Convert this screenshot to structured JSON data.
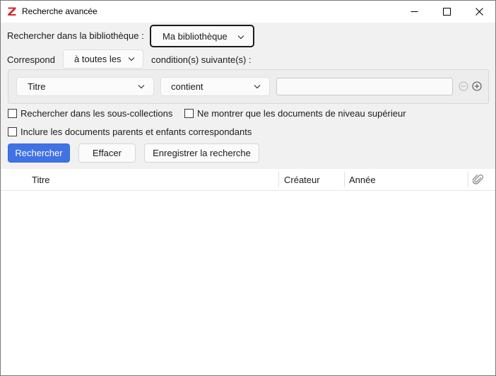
{
  "window": {
    "title": "Recherche avancée"
  },
  "search": {
    "library_label": "Rechercher dans la bibliothèque :",
    "library_value": "Ma bibliothèque",
    "match_label": "Correspond",
    "match_value": "à toutes les",
    "match_suffix": "condition(s) suivante(s) :",
    "condition": {
      "field": "Titre",
      "operator": "contient",
      "value": ""
    },
    "options": {
      "subcollections": "Rechercher dans les sous-collections",
      "top_level": "Ne montrer que les documents de niveau supérieur",
      "parents_children": "Inclure les documents parents et enfants correspondants"
    },
    "buttons": {
      "search": "Rechercher",
      "clear": "Effacer",
      "save": "Enregistrer la recherche"
    }
  },
  "results": {
    "columns": [
      "Titre",
      "Créateur",
      "Année"
    ],
    "rows": []
  },
  "colors": {
    "accent": "#4072e5",
    "logo": "#d9262c",
    "panel": "#f1f1f1"
  },
  "icons": [
    "zotero-logo-icon",
    "minimize-icon",
    "maximize-icon",
    "close-icon",
    "chevron-down-icon",
    "remove-condition-icon",
    "add-condition-icon",
    "attachment-icon"
  ]
}
